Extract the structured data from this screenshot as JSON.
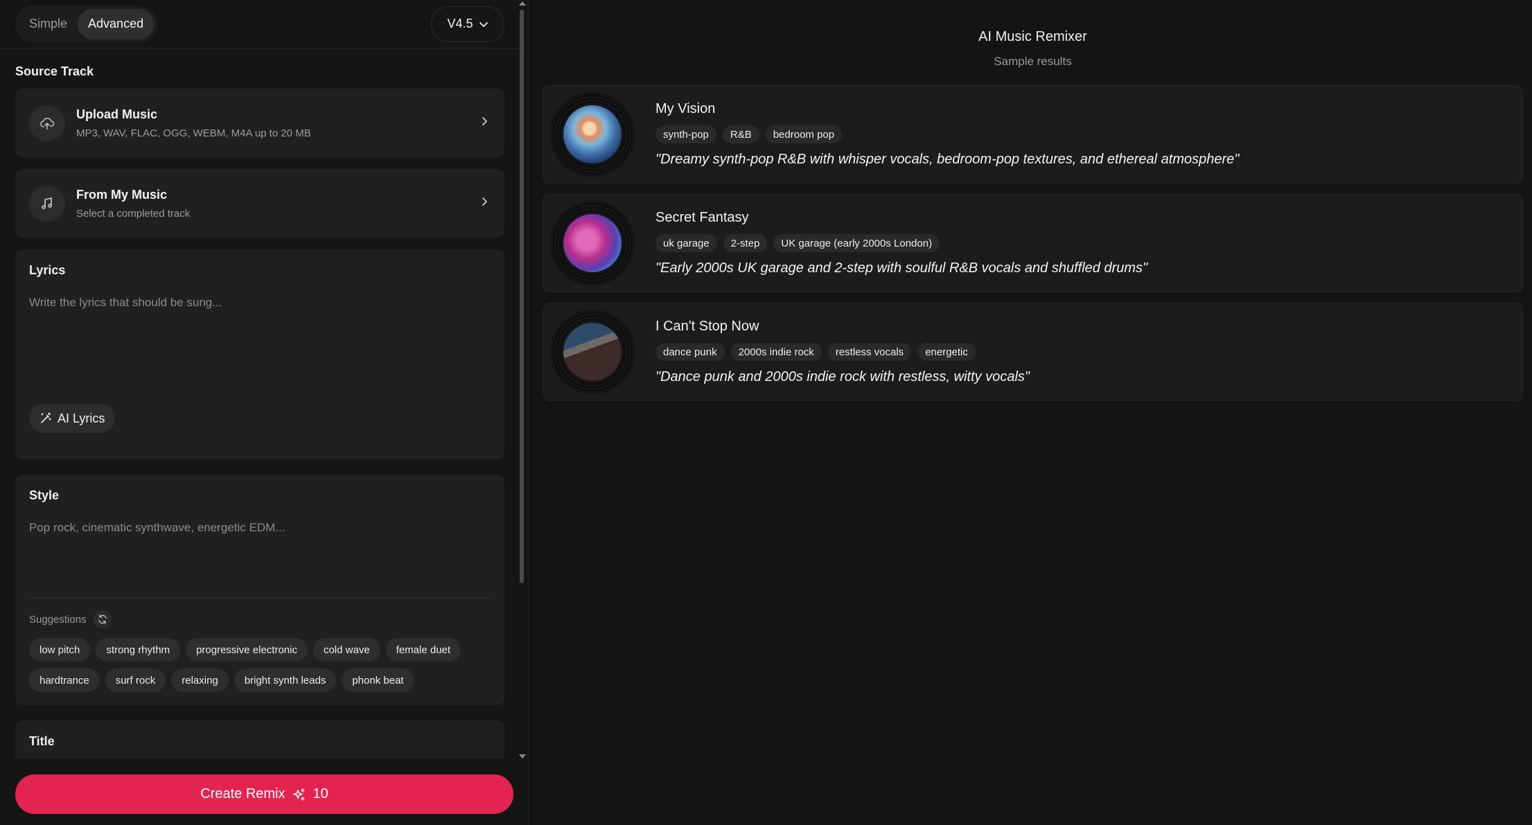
{
  "header": {
    "modes": [
      "Simple",
      "Advanced"
    ],
    "active_mode": "Advanced",
    "version": "V4.5"
  },
  "source": {
    "section_title": "Source Track",
    "upload": {
      "title": "Upload Music",
      "subtitle": "MP3, WAV, FLAC, OGG, WEBM, M4A up to 20 MB"
    },
    "from_library": {
      "title": "From My Music",
      "subtitle": "Select a completed track"
    }
  },
  "lyrics": {
    "label": "Lyrics",
    "placeholder": "Write the lyrics that should be sung...",
    "ai_button": "AI Lyrics"
  },
  "style": {
    "label": "Style",
    "placeholder": "Pop rock, cinematic synthwave, energetic EDM...",
    "suggestions_label": "Suggestions",
    "suggestions": [
      "low pitch",
      "strong rhythm",
      "progressive electronic",
      "cold wave",
      "female duet",
      "hardtrance",
      "surf rock",
      "relaxing",
      "bright synth leads",
      "phonk beat"
    ]
  },
  "title_section": {
    "label": "Title"
  },
  "create": {
    "label": "Create Remix",
    "credits": "10"
  },
  "results": {
    "title": "AI Music Remixer",
    "subtitle": "Sample results",
    "items": [
      {
        "name": "My Vision",
        "tags": [
          "synth-pop",
          "R&B",
          "bedroom pop"
        ],
        "quote": "\"Dreamy synth-pop R&B with whisper vocals, bedroom-pop textures, and ethereal atmosphere\""
      },
      {
        "name": "Secret Fantasy",
        "tags": [
          "uk garage",
          "2-step",
          "UK garage (early 2000s London)"
        ],
        "quote": "\"Early 2000s UK garage and 2-step with soulful R&B vocals and shuffled drums\""
      },
      {
        "name": "I Can't Stop Now",
        "tags": [
          "dance punk",
          "2000s indie rock",
          "restless vocals",
          "energetic"
        ],
        "quote": "\"Dance punk and 2000s indie rock with restless, witty vocals\""
      }
    ]
  },
  "colors": {
    "accent": "#e32451",
    "background": "#141414",
    "card": "#202020"
  }
}
